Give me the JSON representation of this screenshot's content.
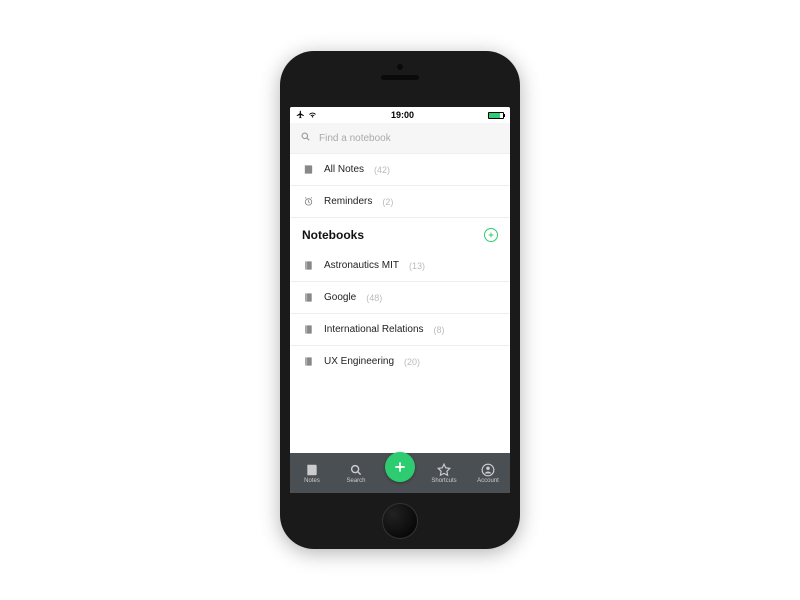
{
  "status_bar": {
    "time": "19:00"
  },
  "search": {
    "placeholder": "Find a notebook"
  },
  "quick": {
    "all_notes_label": "All Notes",
    "all_notes_count": "(42)",
    "reminders_label": "Reminders",
    "reminders_count": "(2)"
  },
  "notebooks_section": {
    "title": "Notebooks",
    "items": [
      {
        "label": "Astronautics MIT",
        "count": "(13)"
      },
      {
        "label": "Google",
        "count": "(48)"
      },
      {
        "label": "International Relations",
        "count": "(8)"
      },
      {
        "label": "UX Engineering",
        "count": "(20)"
      }
    ]
  },
  "tabs": {
    "notes": "Notes",
    "search": "Search",
    "shortcuts": "Shortcuts",
    "account": "Account"
  },
  "colors": {
    "accent": "#2ecc71",
    "tab_bg": "#4a4f53"
  }
}
